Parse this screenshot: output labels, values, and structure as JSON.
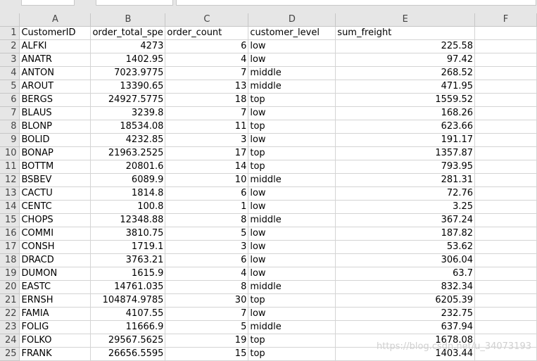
{
  "column_headers": [
    "A",
    "B",
    "C",
    "D",
    "E",
    "F"
  ],
  "row_numbers": [
    "1",
    "2",
    "3",
    "4",
    "5",
    "6",
    "7",
    "8",
    "9",
    "10",
    "11",
    "12",
    "13",
    "14",
    "15",
    "16",
    "17",
    "18",
    "19",
    "20",
    "21",
    "22",
    "23",
    "24",
    "25"
  ],
  "header_row": [
    "CustomerID",
    "order_total_spe",
    "order_count",
    "customer_level",
    "sum_freight",
    ""
  ],
  "rows": [
    [
      "ALFKI",
      "4273",
      "6",
      "low",
      "225.58",
      ""
    ],
    [
      "ANATR",
      "1402.95",
      "4",
      "low",
      "97.42",
      ""
    ],
    [
      "ANTON",
      "7023.9775",
      "7",
      "middle",
      "268.52",
      ""
    ],
    [
      "AROUT",
      "13390.65",
      "13",
      "middle",
      "471.95",
      ""
    ],
    [
      "BERGS",
      "24927.5775",
      "18",
      "top",
      "1559.52",
      ""
    ],
    [
      "BLAUS",
      "3239.8",
      "7",
      "low",
      "168.26",
      ""
    ],
    [
      "BLONP",
      "18534.08",
      "11",
      "top",
      "623.66",
      ""
    ],
    [
      "BOLID",
      "4232.85",
      "3",
      "low",
      "191.17",
      ""
    ],
    [
      "BONAP",
      "21963.2525",
      "17",
      "top",
      "1357.87",
      ""
    ],
    [
      "BOTTM",
      "20801.6",
      "14",
      "top",
      "793.95",
      ""
    ],
    [
      "BSBEV",
      "6089.9",
      "10",
      "middle",
      "281.31",
      ""
    ],
    [
      "CACTU",
      "1814.8",
      "6",
      "low",
      "72.76",
      ""
    ],
    [
      "CENTC",
      "100.8",
      "1",
      "low",
      "3.25",
      ""
    ],
    [
      "CHOPS",
      "12348.88",
      "8",
      "middle",
      "367.24",
      ""
    ],
    [
      "COMMI",
      "3810.75",
      "5",
      "low",
      "187.82",
      ""
    ],
    [
      "CONSH",
      "1719.1",
      "3",
      "low",
      "53.62",
      ""
    ],
    [
      "DRACD",
      "3763.21",
      "6",
      "low",
      "306.04",
      ""
    ],
    [
      "DUMON",
      "1615.9",
      "4",
      "low",
      "63.7",
      ""
    ],
    [
      "EASTC",
      "14761.035",
      "8",
      "middle",
      "832.34",
      ""
    ],
    [
      "ERNSH",
      "104874.9785",
      "30",
      "top",
      "6205.39",
      ""
    ],
    [
      "FAMIA",
      "4107.55",
      "7",
      "low",
      "232.75",
      ""
    ],
    [
      "FOLIG",
      "11666.9",
      "5",
      "middle",
      "637.94",
      ""
    ],
    [
      "FOLKO",
      "29567.5625",
      "19",
      "top",
      "1678.08",
      ""
    ],
    [
      "FRANK",
      "26656.5595",
      "15",
      "top",
      "1403.44",
      ""
    ]
  ],
  "watermark": "https://blog.csdn.net/u_34073193"
}
